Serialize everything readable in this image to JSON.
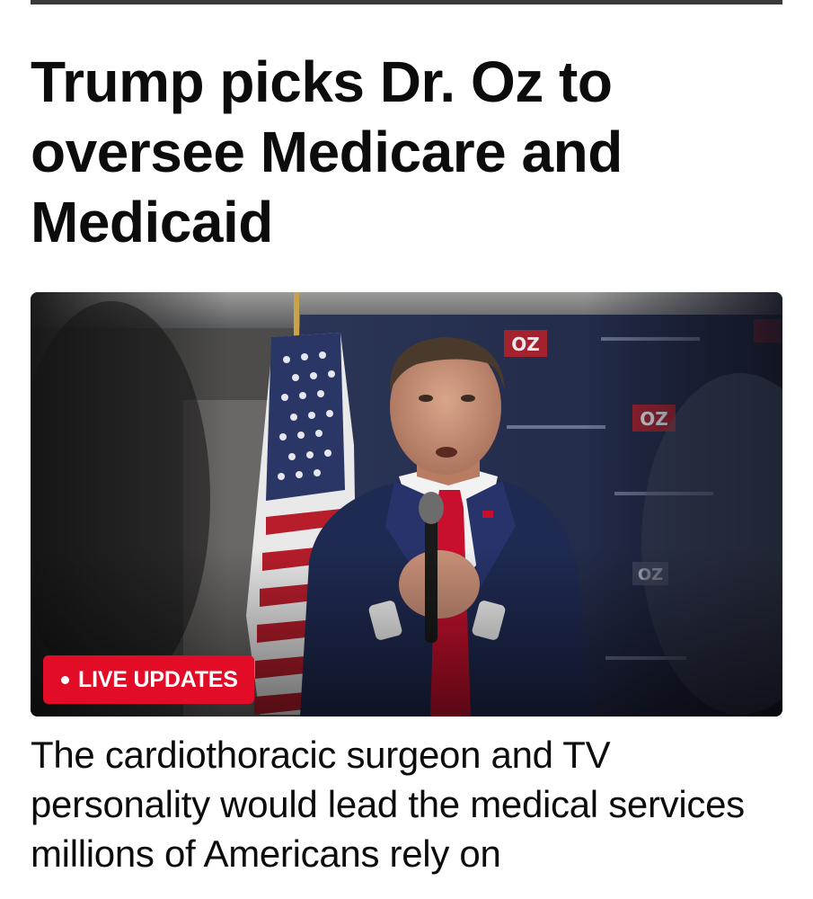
{
  "article": {
    "headline": "Trump picks Dr. Oz to oversee Medicare and Medicaid",
    "hero_badge": "LIVE UPDATES",
    "summary": "The cardiothoracic surgeon and TV personality would lead the medical services millions of Americans rely on"
  },
  "image": {
    "backdrop_text": "OZ",
    "colors": {
      "badge": "#e20c27",
      "backdrop": "#232c4a",
      "suit": "#1f2a52",
      "tie": "#c8102e"
    }
  }
}
